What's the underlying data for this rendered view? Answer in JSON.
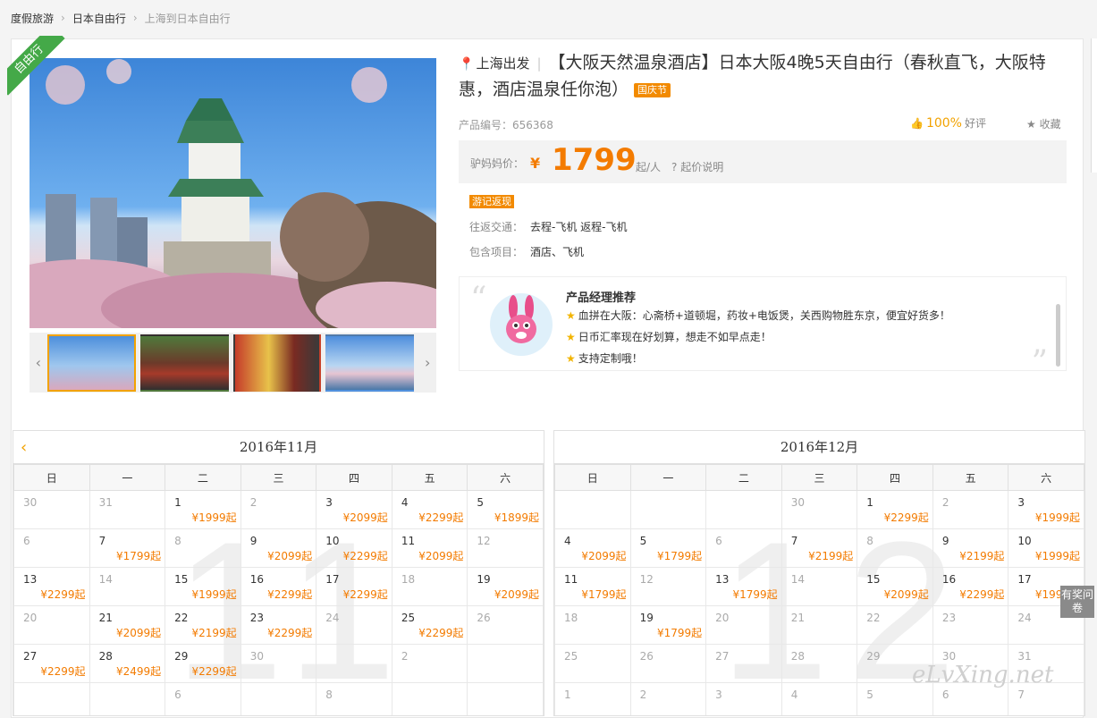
{
  "breadcrumb": {
    "items": [
      "度假旅游",
      "日本自由行",
      "上海到日本自由行"
    ]
  },
  "ribbon": "自由行",
  "product": {
    "departure": "上海出发",
    "title": "【大阪天然温泉酒店】日本大阪4晚5天自由行（春秋直飞，大阪特惠，酒店温泉任你泡）",
    "festival_tag": "国庆节",
    "id_label": "产品编号：",
    "id_value": "656368",
    "rating_pct": "100%",
    "rating_label": "好评",
    "fav_label": "收藏"
  },
  "price": {
    "label": "驴妈妈价：",
    "currency": "¥",
    "value": "1799",
    "unit": "起/人",
    "explain": "起价说明"
  },
  "info": {
    "youji_tag": "游记返现",
    "traffic_label": "往返交通：",
    "traffic_value": "去程-飞机   返程-飞机",
    "include_label": "包含项目：",
    "include_value": "酒店、飞机"
  },
  "recommend": {
    "title": "产品经理推荐",
    "items": [
      "血拼在大阪：心斋桥+道顿堀，药妆+电饭煲，关西购物胜东京，便宜好货多！",
      "日币汇率现在好划算，想走不如早点走！",
      "支持定制哦！"
    ]
  },
  "weekdays": [
    "日",
    "一",
    "二",
    "三",
    "四",
    "五",
    "六"
  ],
  "calendars": [
    {
      "title": "2016年11月",
      "big": "11",
      "rows": [
        [
          {
            "d": "30",
            "off": true
          },
          {
            "d": "31",
            "off": true
          },
          {
            "d": "1",
            "p": "¥1999起"
          },
          {
            "d": "2",
            "off": true
          },
          {
            "d": "3",
            "p": "¥2099起"
          },
          {
            "d": "4",
            "p": "¥2299起"
          },
          {
            "d": "5",
            "p": "¥1899起"
          }
        ],
        [
          {
            "d": "6",
            "off": true
          },
          {
            "d": "7",
            "p": "¥1799起"
          },
          {
            "d": "8",
            "off": true
          },
          {
            "d": "9",
            "p": "¥2099起"
          },
          {
            "d": "10",
            "p": "¥2299起"
          },
          {
            "d": "11",
            "p": "¥2099起"
          },
          {
            "d": "12",
            "off": true
          }
        ],
        [
          {
            "d": "13",
            "p": "¥2299起"
          },
          {
            "d": "14",
            "off": true
          },
          {
            "d": "15",
            "p": "¥1999起"
          },
          {
            "d": "16",
            "p": "¥2299起"
          },
          {
            "d": "17",
            "p": "¥2299起"
          },
          {
            "d": "18",
            "off": true
          },
          {
            "d": "19",
            "p": "¥2099起"
          }
        ],
        [
          {
            "d": "20",
            "off": true
          },
          {
            "d": "21",
            "p": "¥2099起"
          },
          {
            "d": "22",
            "p": "¥2199起"
          },
          {
            "d": "23",
            "p": "¥2299起"
          },
          {
            "d": "24",
            "off": true
          },
          {
            "d": "25",
            "p": "¥2299起"
          },
          {
            "d": "26",
            "off": true
          }
        ],
        [
          {
            "d": "27",
            "p": "¥2299起"
          },
          {
            "d": "28",
            "p": "¥2499起"
          },
          {
            "d": "29",
            "p": "¥2299起"
          },
          {
            "d": "30",
            "off": true
          },
          {
            "d": "",
            "off": true
          },
          {
            "d": "2",
            "off": true
          },
          {
            "d": "",
            "off": true
          }
        ],
        [
          {
            "d": "",
            "off": true
          },
          {
            "d": "",
            "off": true
          },
          {
            "d": "6",
            "off": true
          },
          {
            "d": "",
            "off": true
          },
          {
            "d": "8",
            "off": true
          },
          {
            "d": "",
            "off": true
          },
          {
            "d": "",
            "off": true
          }
        ]
      ]
    },
    {
      "title": "2016年12月",
      "big": "12",
      "rows": [
        [
          {
            "d": "",
            "off": true
          },
          {
            "d": "",
            "off": true
          },
          {
            "d": "",
            "off": true
          },
          {
            "d": "30",
            "off": true
          },
          {
            "d": "1",
            "p": "¥2299起"
          },
          {
            "d": "2",
            "off": true
          },
          {
            "d": "3",
            "p": "¥1999起"
          }
        ],
        [
          {
            "d": "4",
            "p": "¥2099起"
          },
          {
            "d": "5",
            "p": "¥1799起"
          },
          {
            "d": "6",
            "off": true
          },
          {
            "d": "7",
            "p": "¥2199起"
          },
          {
            "d": "8",
            "off": true
          },
          {
            "d": "9",
            "p": "¥2199起"
          },
          {
            "d": "10",
            "p": "¥1999起"
          }
        ],
        [
          {
            "d": "11",
            "p": "¥1799起"
          },
          {
            "d": "12",
            "off": true
          },
          {
            "d": "13",
            "p": "¥1799起"
          },
          {
            "d": "14",
            "off": true
          },
          {
            "d": "15",
            "p": "¥2099起"
          },
          {
            "d": "16",
            "p": "¥2299起"
          },
          {
            "d": "17",
            "p": "¥1999起"
          }
        ],
        [
          {
            "d": "18",
            "off": true
          },
          {
            "d": "19",
            "p": "¥1799起"
          },
          {
            "d": "20",
            "off": true
          },
          {
            "d": "21",
            "off": true
          },
          {
            "d": "22",
            "off": true
          },
          {
            "d": "23",
            "off": true
          },
          {
            "d": "24",
            "off": true
          }
        ],
        [
          {
            "d": "25",
            "off": true
          },
          {
            "d": "26",
            "off": true
          },
          {
            "d": "27",
            "off": true
          },
          {
            "d": "28",
            "off": true
          },
          {
            "d": "29",
            "off": true
          },
          {
            "d": "30",
            "off": true
          },
          {
            "d": "31",
            "off": true
          }
        ],
        [
          {
            "d": "1",
            "off": true
          },
          {
            "d": "2",
            "off": true
          },
          {
            "d": "3",
            "off": true
          },
          {
            "d": "4",
            "off": true
          },
          {
            "d": "5",
            "off": true
          },
          {
            "d": "6",
            "off": true
          },
          {
            "d": "7",
            "off": true
          }
        ]
      ]
    }
  ],
  "survey": "有奖问卷",
  "watermark": "eLvXing.net",
  "colors": {
    "accent": "#f37b00",
    "ribbon": "#44a948"
  }
}
